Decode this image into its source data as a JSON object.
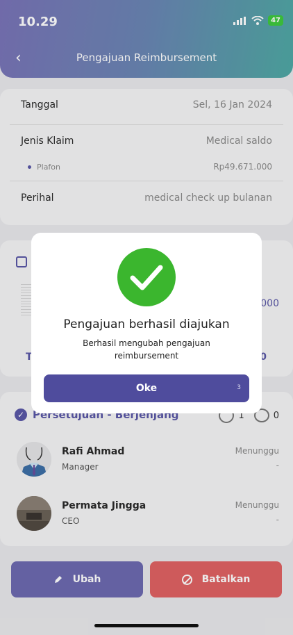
{
  "status_bar": {
    "time": "10.29",
    "battery": "47"
  },
  "header": {
    "title": "Pengajuan Reimbursement"
  },
  "detail": {
    "tanggal_label": "Tanggal",
    "tanggal_value": "Sel, 16 Jan 2024",
    "jenis_label": "Jenis Klaim",
    "jenis_value": "Medical saldo",
    "plafon_label": "Plafon",
    "plafon_value": "Rp49.671.000",
    "perihal_label": "Perihal",
    "perihal_value": "medical check up bulanan"
  },
  "attachment_fragments": {
    "amount": "000",
    "t": "T",
    "zero": "0"
  },
  "approval": {
    "title": "Persetujuan - Berjenjang",
    "views": "1",
    "comments": "0",
    "people": [
      {
        "name": "Rafi Ahmad",
        "role": "Manager",
        "status": "Menunggu",
        "note": "-"
      },
      {
        "name": "Permata Jingga",
        "role": "CEO",
        "status": "Menunggu",
        "note": "-"
      }
    ]
  },
  "actions": {
    "ubah": "Ubah",
    "batalkan": "Batalkan"
  },
  "modal": {
    "title": "Pengajuan berhasil diajukan",
    "message": "Berhasil mengubah pengajuan reimbursement",
    "ok_label": "Oke",
    "countdown": "3"
  },
  "colors": {
    "primary": "#4f4c9d",
    "danger": "#e06263",
    "success": "#3bb62e"
  }
}
